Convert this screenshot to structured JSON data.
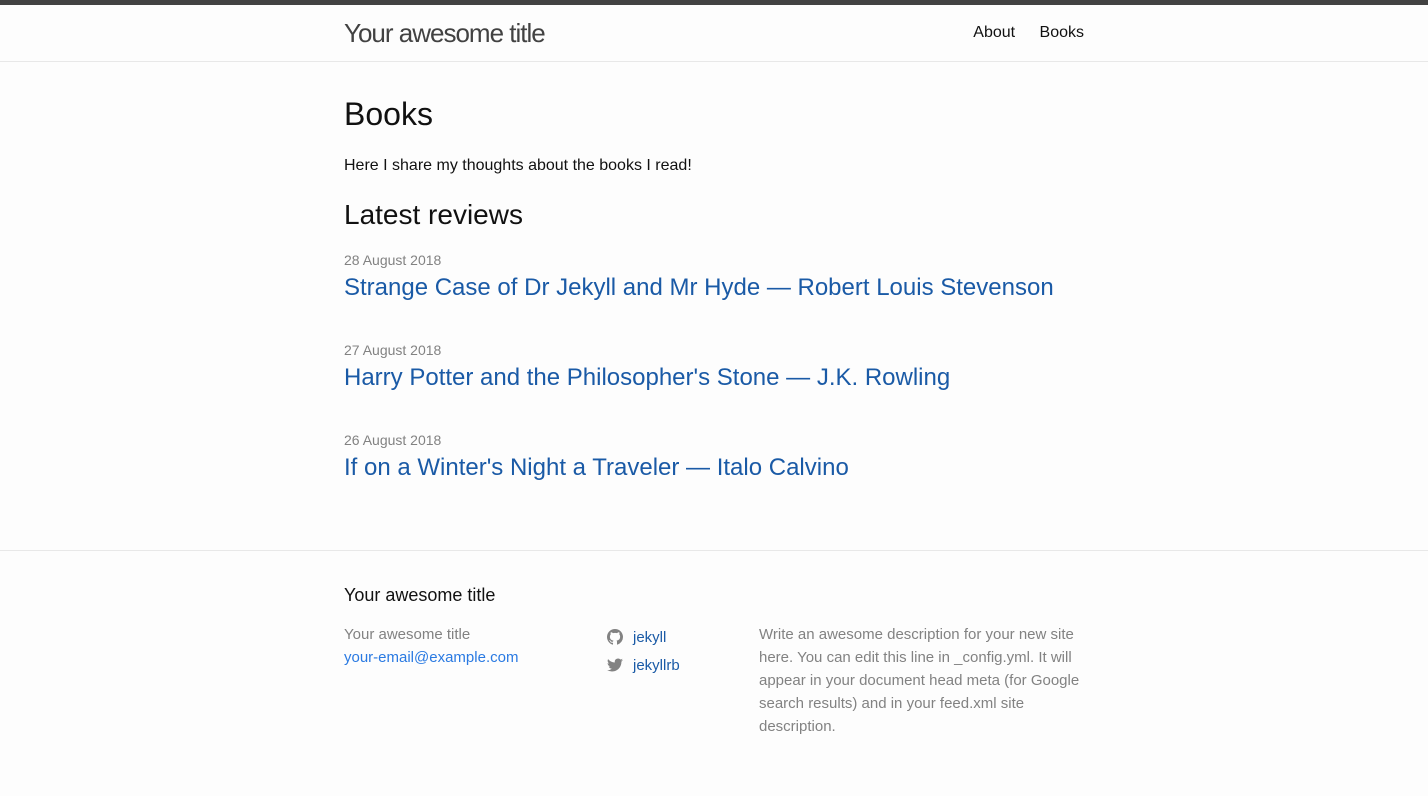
{
  "header": {
    "site_title": "Your awesome title",
    "nav": [
      {
        "label": "About"
      },
      {
        "label": "Books"
      }
    ]
  },
  "main": {
    "heading": "Books",
    "intro": "Here I share my thoughts about the books I read!",
    "reviews_heading": "Latest reviews",
    "posts": [
      {
        "date": "28 August 2018",
        "title": "Strange Case of Dr Jekyll and Mr Hyde — Robert Louis Stevenson"
      },
      {
        "date": "27 August 2018",
        "title": "Harry Potter and the Philosopher's Stone — J.K. Rowling"
      },
      {
        "date": "26 August 2018",
        "title": "If on a Winter's Night a Traveler — Italo Calvino"
      }
    ]
  },
  "footer": {
    "heading": "Your awesome title",
    "contact_name": "Your awesome title",
    "email": "your-email@example.com",
    "social": [
      {
        "icon": "github-icon",
        "label": "jekyll"
      },
      {
        "icon": "twitter-icon",
        "label": "jekyllrb"
      }
    ],
    "description": "Write an awesome description for your new site here. You can edit this line in _config.yml. It will appear in your document head meta (for Google search results) and in your feed.xml site description."
  },
  "colors": {
    "link": "#1a5aa6",
    "email_link": "#2a7ae2",
    "muted_text": "#828282",
    "header_border_top": "#424242"
  }
}
